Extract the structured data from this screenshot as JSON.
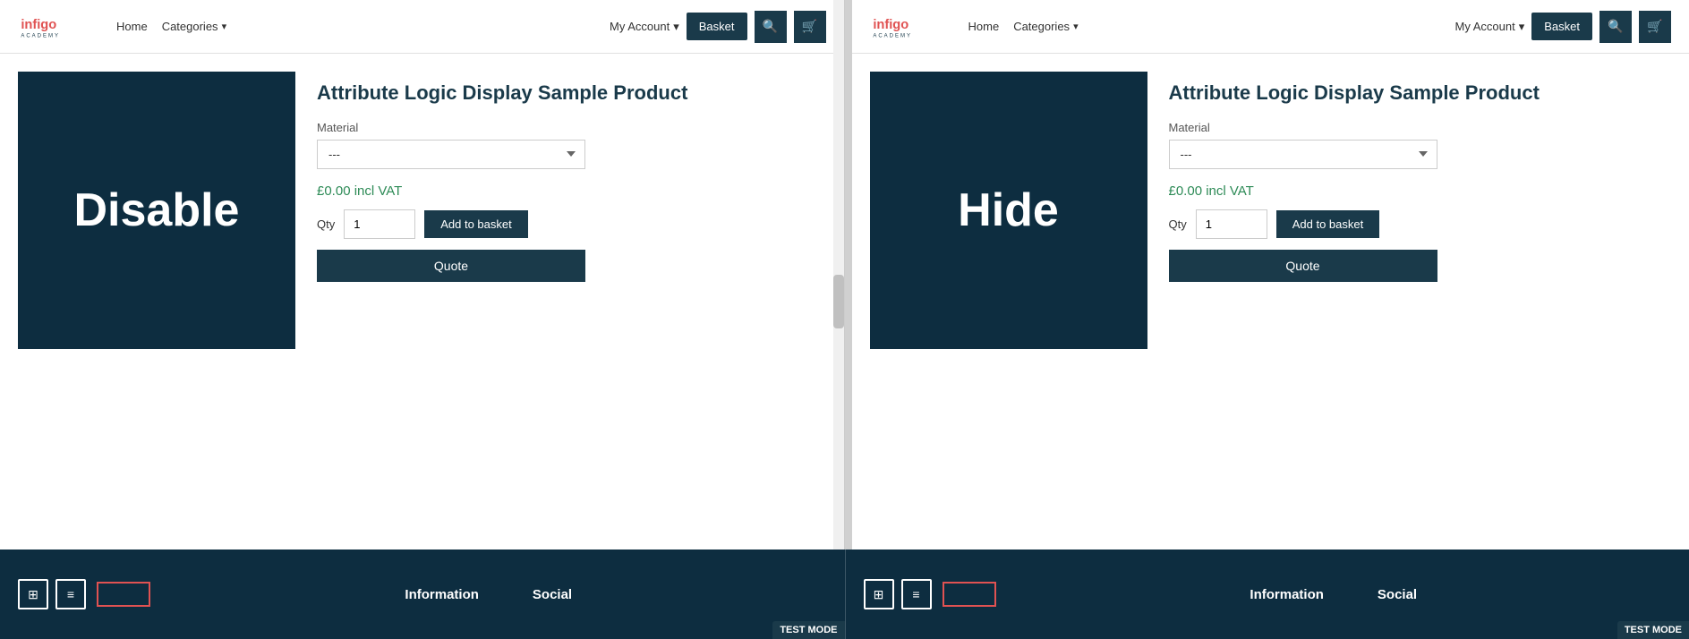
{
  "left_panel": {
    "nav": {
      "home_label": "Home",
      "categories_label": "Categories",
      "my_account_label": "My Account",
      "basket_label": "Basket"
    },
    "product": {
      "image_text": "Disable",
      "title": "Attribute Logic Display Sample Product",
      "material_label": "Material",
      "material_placeholder": "---",
      "price": "£0.00 incl VAT",
      "qty_label": "Qty",
      "qty_value": "1",
      "add_basket_label": "Add to basket",
      "quote_label": "Quote"
    },
    "footer": {
      "information_label": "Information",
      "social_label": "Social",
      "test_mode_label": "TEST MODE"
    }
  },
  "right_panel": {
    "nav": {
      "home_label": "Home",
      "categories_label": "Categories",
      "my_account_label": "My Account",
      "basket_label": "Basket"
    },
    "product": {
      "image_text": "Hide",
      "title": "Attribute Logic Display Sample Product",
      "material_label": "Material",
      "material_placeholder": "---",
      "price": "£0.00 incl VAT",
      "qty_label": "Qty",
      "qty_value": "1",
      "add_basket_label": "Add to basket",
      "quote_label": "Quote"
    },
    "footer": {
      "information_label": "Information",
      "social_label": "Social",
      "test_mode_label": "TEST MODE"
    }
  },
  "icons": {
    "search": "🔍",
    "cart": "🛒",
    "grid": "⊞",
    "list": "≡",
    "chevron_down": "▾"
  }
}
